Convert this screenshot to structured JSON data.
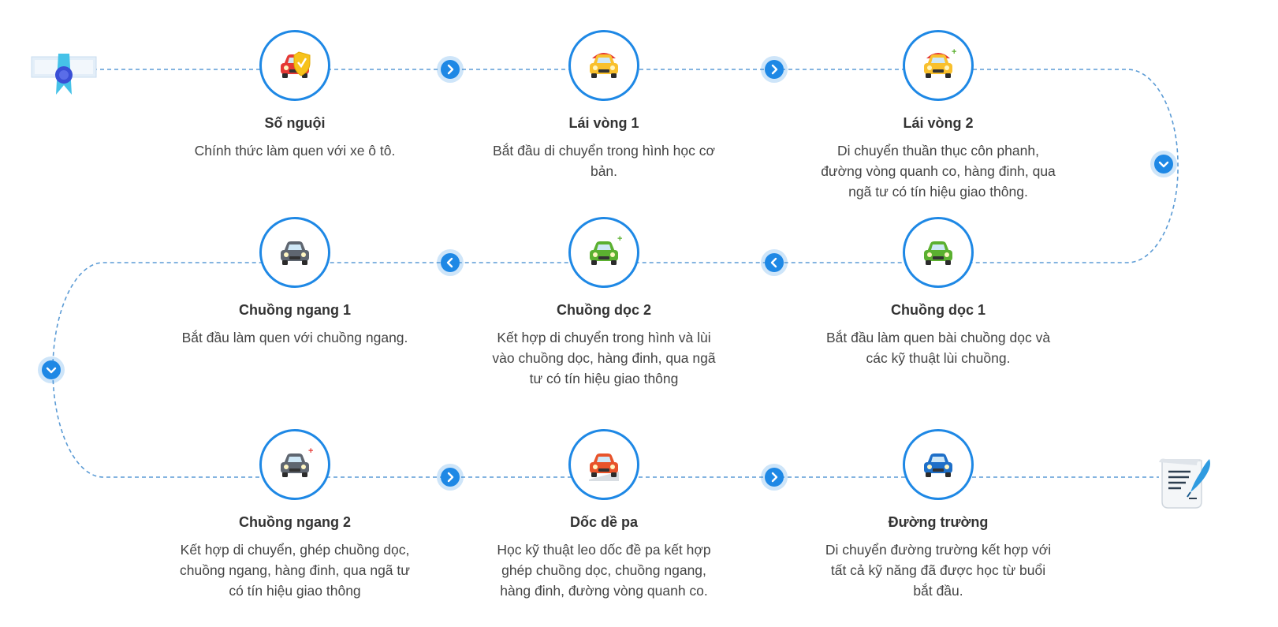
{
  "colors": {
    "accent": "#1e88e5",
    "path": "#5b9bd5",
    "title": "#333333",
    "text": "#444444"
  },
  "steps": [
    {
      "title": "Số nguội",
      "desc": "Chính thức làm quen với xe ô tô.",
      "icon": "car-shield-icon",
      "car_color": "#e53935",
      "badge": ""
    },
    {
      "title": "Lái vòng 1",
      "desc": "Bắt đầu di chuyển trong hình học cơ bản.",
      "icon": "car-umbrella-icon",
      "car_color": "#f9c02d",
      "badge": ""
    },
    {
      "title": "Lái vòng 2",
      "desc": "Di chuyển thuần thục côn phanh, đường vòng quanh co, hàng đinh, qua ngã tư có tín hiệu giao thông.",
      "icon": "car-umbrella-plus-icon",
      "car_color": "#f9c02d",
      "badge": "+"
    },
    {
      "title": "Chuồng ngang 1",
      "desc": "Bắt đầu làm quen với chuồng ngang.",
      "icon": "car-grey-icon",
      "car_color": "#5f6670",
      "badge": ""
    },
    {
      "title": "Chuồng dọc 2",
      "desc": "Kết hợp di chuyển trong hình và lùi vào chuồng dọc, hàng đinh, qua ngã tư có tín hiệu giao thông",
      "icon": "car-green-plus-icon",
      "car_color": "#5bb030",
      "badge": "+"
    },
    {
      "title": "Chuồng dọc 1",
      "desc": "Bắt đầu làm quen bài chuồng dọc và các kỹ thuật lùi chuồng.",
      "icon": "car-green-icon",
      "car_color": "#5bb030",
      "badge": ""
    },
    {
      "title": "Chuồng ngang 2",
      "desc": "Kết hợp di chuyển, ghép chuồng dọc, chuồng ngang, hàng đinh, qua ngã tư có tín hiệu giao thông",
      "icon": "car-grey-plus-icon",
      "car_color": "#5f6670",
      "badge": "+"
    },
    {
      "title": "Dốc dề pa",
      "desc": "Học kỹ thuật leo dốc đề pa kết hợp ghép chuồng dọc, chuồng ngang, hàng đinh, đường vòng quanh co.",
      "icon": "car-hill-icon",
      "car_color": "#e8532a",
      "badge": ""
    },
    {
      "title": "Đường trường",
      "desc": "Di chuyển đường trường kết hợp với tất cả kỹ năng đã được học từ buổi bắt đầu.",
      "icon": "car-blue-icon",
      "car_color": "#1e6fc8",
      "badge": ""
    }
  ],
  "connectors": [
    {
      "dir": "right",
      "icon": "chevron-right-icon"
    },
    {
      "dir": "right",
      "icon": "chevron-right-icon"
    },
    {
      "dir": "down",
      "icon": "chevron-down-icon"
    },
    {
      "dir": "left",
      "icon": "chevron-left-icon"
    },
    {
      "dir": "left",
      "icon": "chevron-left-icon"
    },
    {
      "dir": "down",
      "icon": "chevron-down-icon"
    },
    {
      "dir": "right",
      "icon": "chevron-right-icon"
    },
    {
      "dir": "right",
      "icon": "chevron-right-icon"
    }
  ],
  "start_icon": "certificate-ribbon-icon",
  "end_icon": "scroll-quill-icon"
}
